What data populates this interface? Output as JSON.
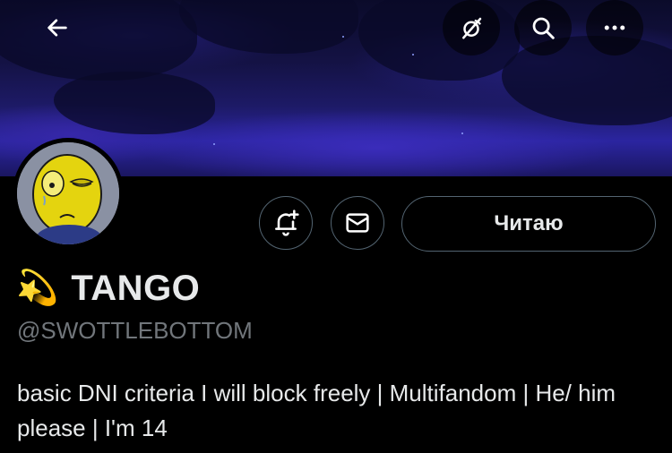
{
  "header": {
    "back_icon": "arrow-left-icon",
    "top_actions": [
      {
        "name": "satellite-off-icon"
      },
      {
        "name": "search-icon"
      },
      {
        "name": "more-icon"
      }
    ]
  },
  "profile": {
    "name_emoji": "💫",
    "display_name": "TANGO",
    "handle": "@SWOTTLEBOTTOM",
    "bio": "basic DNI criteria I will block freely | Multifandom | He/ him please | I'm 14"
  },
  "actions": {
    "notify_icon": "bell-plus-icon",
    "message_icon": "mail-icon",
    "follow_label": "Читаю"
  },
  "colors": {
    "background": "#000000",
    "text_primary": "#e7e9ea",
    "text_secondary": "#71767b",
    "button_border": "#536471"
  }
}
